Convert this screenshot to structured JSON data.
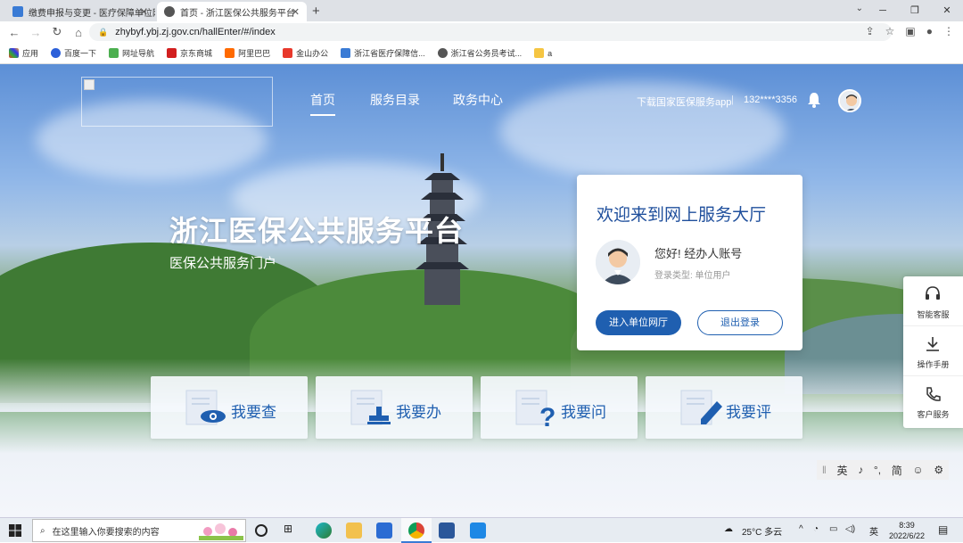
{
  "browser": {
    "tabs": [
      {
        "title": "缴费申报与变更 - 医疗保障单位网...",
        "active": false
      },
      {
        "title": "首页 - 浙江医保公共服务平台",
        "active": true
      }
    ],
    "url": "zhybyf.ybj.zj.gov.cn/hallEnter/#/index",
    "bookmarks": [
      "应用",
      "百度一下",
      "网址导航",
      "京东商城",
      "阿里巴巴",
      "金山办公",
      "浙江省医疗保障信...",
      "浙江省公务员考试...",
      "a"
    ]
  },
  "header": {
    "nav": [
      "首页",
      "服务目录",
      "政务中心"
    ],
    "download_app": "下载国家医保服务app",
    "separator": "|",
    "phone": "132****3356"
  },
  "hero": {
    "title": "浙江医保公共服务平台",
    "subtitle": "医保公共服务门户"
  },
  "welcome": {
    "heading": "欢迎来到网上服务大厅",
    "greeting": "您好!  经办人账号",
    "login_type": "登录类型:  单位用户",
    "enter_button": "进入单位网厅",
    "logout_button": "退出登录"
  },
  "services": [
    "我要查",
    "我要办",
    "我要问",
    "我要评"
  ],
  "sidebar": [
    "智能客服",
    "操作手册",
    "客户服务"
  ],
  "ime": [
    "英",
    "♪",
    "°,",
    "简",
    "☺",
    "⚙"
  ],
  "taskbar": {
    "search_placeholder": "在这里输入你要搜索的内容",
    "weather": "25°C  多云",
    "tray_text": "英",
    "time": "8:39",
    "date": "2022/6/22"
  },
  "colors": {
    "primary": "#1f5fb0",
    "heading": "#1f4f9c"
  }
}
